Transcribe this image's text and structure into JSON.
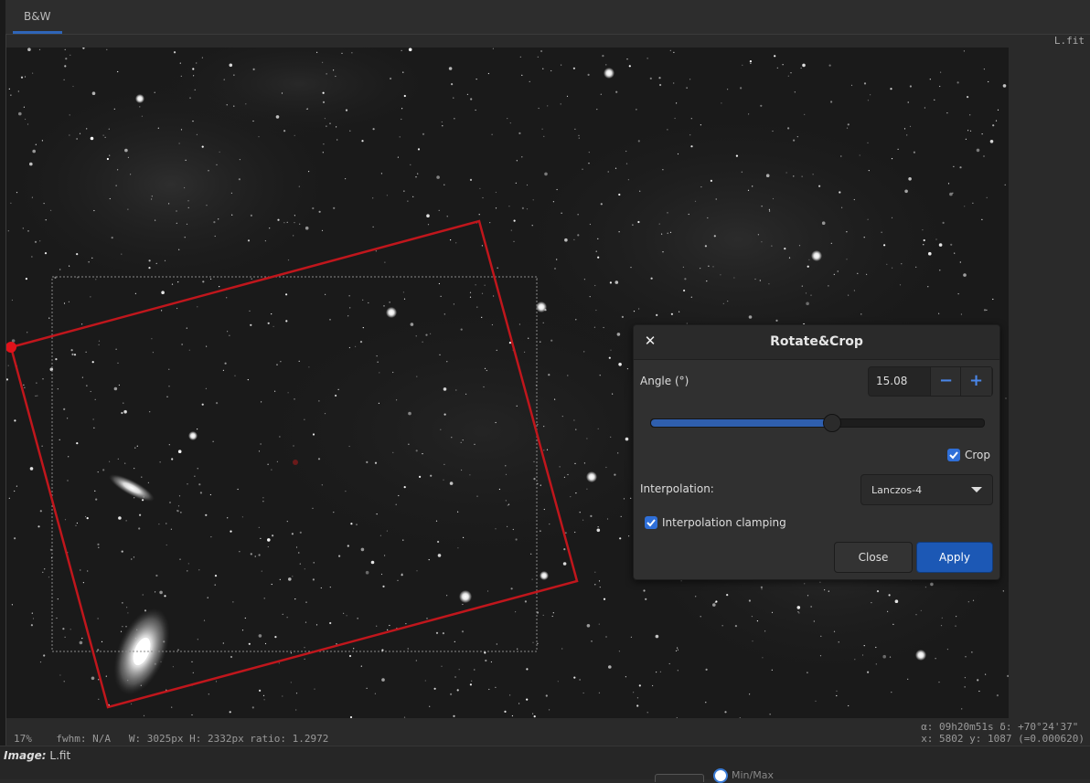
{
  "tabs": [
    {
      "label": "B&W",
      "active": true
    }
  ],
  "image_filename": "L.fit",
  "status": {
    "zoom": "17%",
    "fwhm": "fwhm: N/A",
    "dimensions": "W: 3025px H: 2332px ratio: 1.2972",
    "coords_world": "α: 09h20m51s δ: +70°24'37\"",
    "coords_pixel": "x: 5802 y: 1087 (=0.000620)"
  },
  "info": {
    "image_label": "Image:",
    "image_name": "L.fit",
    "minmax_label": "Min/Max"
  },
  "dialog": {
    "title": "Rotate&Crop",
    "close_icon": "close-icon",
    "angle_label": "Angle (°)",
    "angle_value": "15.08",
    "angle_slider_fraction": 0.54,
    "minus_icon": "minus-icon",
    "plus_icon": "plus-icon",
    "crop_label": "Crop",
    "crop_checked": true,
    "interpolation_label": "Interpolation:",
    "interpolation_value": "Lanczos-4",
    "clamping_label": "Interpolation clamping",
    "clamping_checked": true,
    "close_button": "Close",
    "apply_button": "Apply"
  },
  "colors": {
    "accent": "#2f6fd8",
    "crop_outline": "#c0161c",
    "apply_button": "#1c58b5"
  }
}
